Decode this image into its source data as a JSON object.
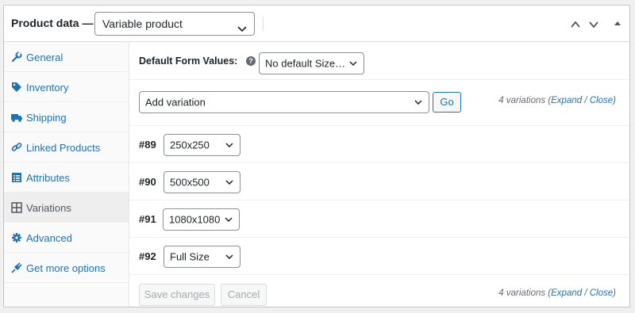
{
  "header": {
    "title": "Product data —",
    "product_type": "Variable product"
  },
  "sidebar": {
    "items": [
      {
        "label": "General",
        "icon": "wrench-icon"
      },
      {
        "label": "Inventory",
        "icon": "tag-icon"
      },
      {
        "label": "Shipping",
        "icon": "truck-icon"
      },
      {
        "label": "Linked Products",
        "icon": "link-icon"
      },
      {
        "label": "Attributes",
        "icon": "list-icon"
      },
      {
        "label": "Variations",
        "icon": "grid-icon",
        "active": true
      },
      {
        "label": "Advanced",
        "icon": "gear-icon"
      },
      {
        "label": "Get more options",
        "icon": "plug-icon"
      }
    ]
  },
  "defaults": {
    "label": "Default Form Values:",
    "help": "?",
    "value": "No default Size…"
  },
  "add_variation": {
    "value": "Add variation",
    "go_label": "Go"
  },
  "counts": {
    "text": "4 variations (",
    "expand": "Expand",
    "slash": " / ",
    "close": "Close",
    "end": ")"
  },
  "variations": [
    {
      "id": "#89",
      "size": "250x250"
    },
    {
      "id": "#90",
      "size": "500x500"
    },
    {
      "id": "#91",
      "size": "1080x1080"
    },
    {
      "id": "#92",
      "size": "Full Size"
    }
  ],
  "footer": {
    "save_label": "Save changes",
    "cancel_label": "Cancel"
  },
  "colors": {
    "link": "#2271b1",
    "border": "#c3c4c7",
    "disabled_text": "#a7aaad"
  }
}
